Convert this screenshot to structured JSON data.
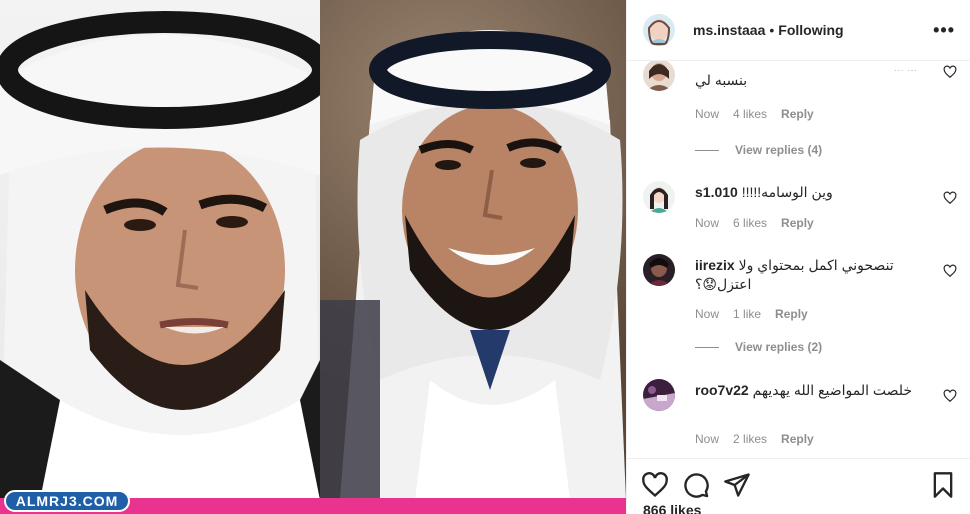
{
  "header": {
    "username": "ms.instaaa",
    "separator": "•",
    "follow_label": "Following",
    "more_label": "•••"
  },
  "comments": [
    {
      "user": "",
      "text": "بنسبه لي",
      "partial_top": "... ...",
      "time": "Now",
      "likes": "4 likes",
      "reply": "Reply",
      "view_replies": "View replies (4)"
    },
    {
      "user": "s1.010",
      "text": "!!!!!وين الوسامه",
      "time": "Now",
      "likes": "6 likes",
      "reply": "Reply"
    },
    {
      "user": "iirezix",
      "text": "تنصحوني اكمل بمحتواي ولا اعتزل😟؟",
      "time": "Now",
      "likes": "1 like",
      "reply": "Reply",
      "view_replies": "View replies (2)"
    },
    {
      "user": "roo7v22",
      "text": "خلصت المواضيع الله يهديهم",
      "time": "Now",
      "likes": "2 likes",
      "reply": "Reply"
    }
  ],
  "likes_count": "866 likes",
  "watermark": "ALMRJ3.COM",
  "colors": {
    "accent_pink": "#e8338f",
    "watermark_blue": "#1f5fa8",
    "text": "#262626",
    "muted": "#8e8e8e"
  },
  "icons": [
    "heart-icon",
    "comment-icon",
    "share-icon",
    "bookmark-icon",
    "more-icon"
  ]
}
